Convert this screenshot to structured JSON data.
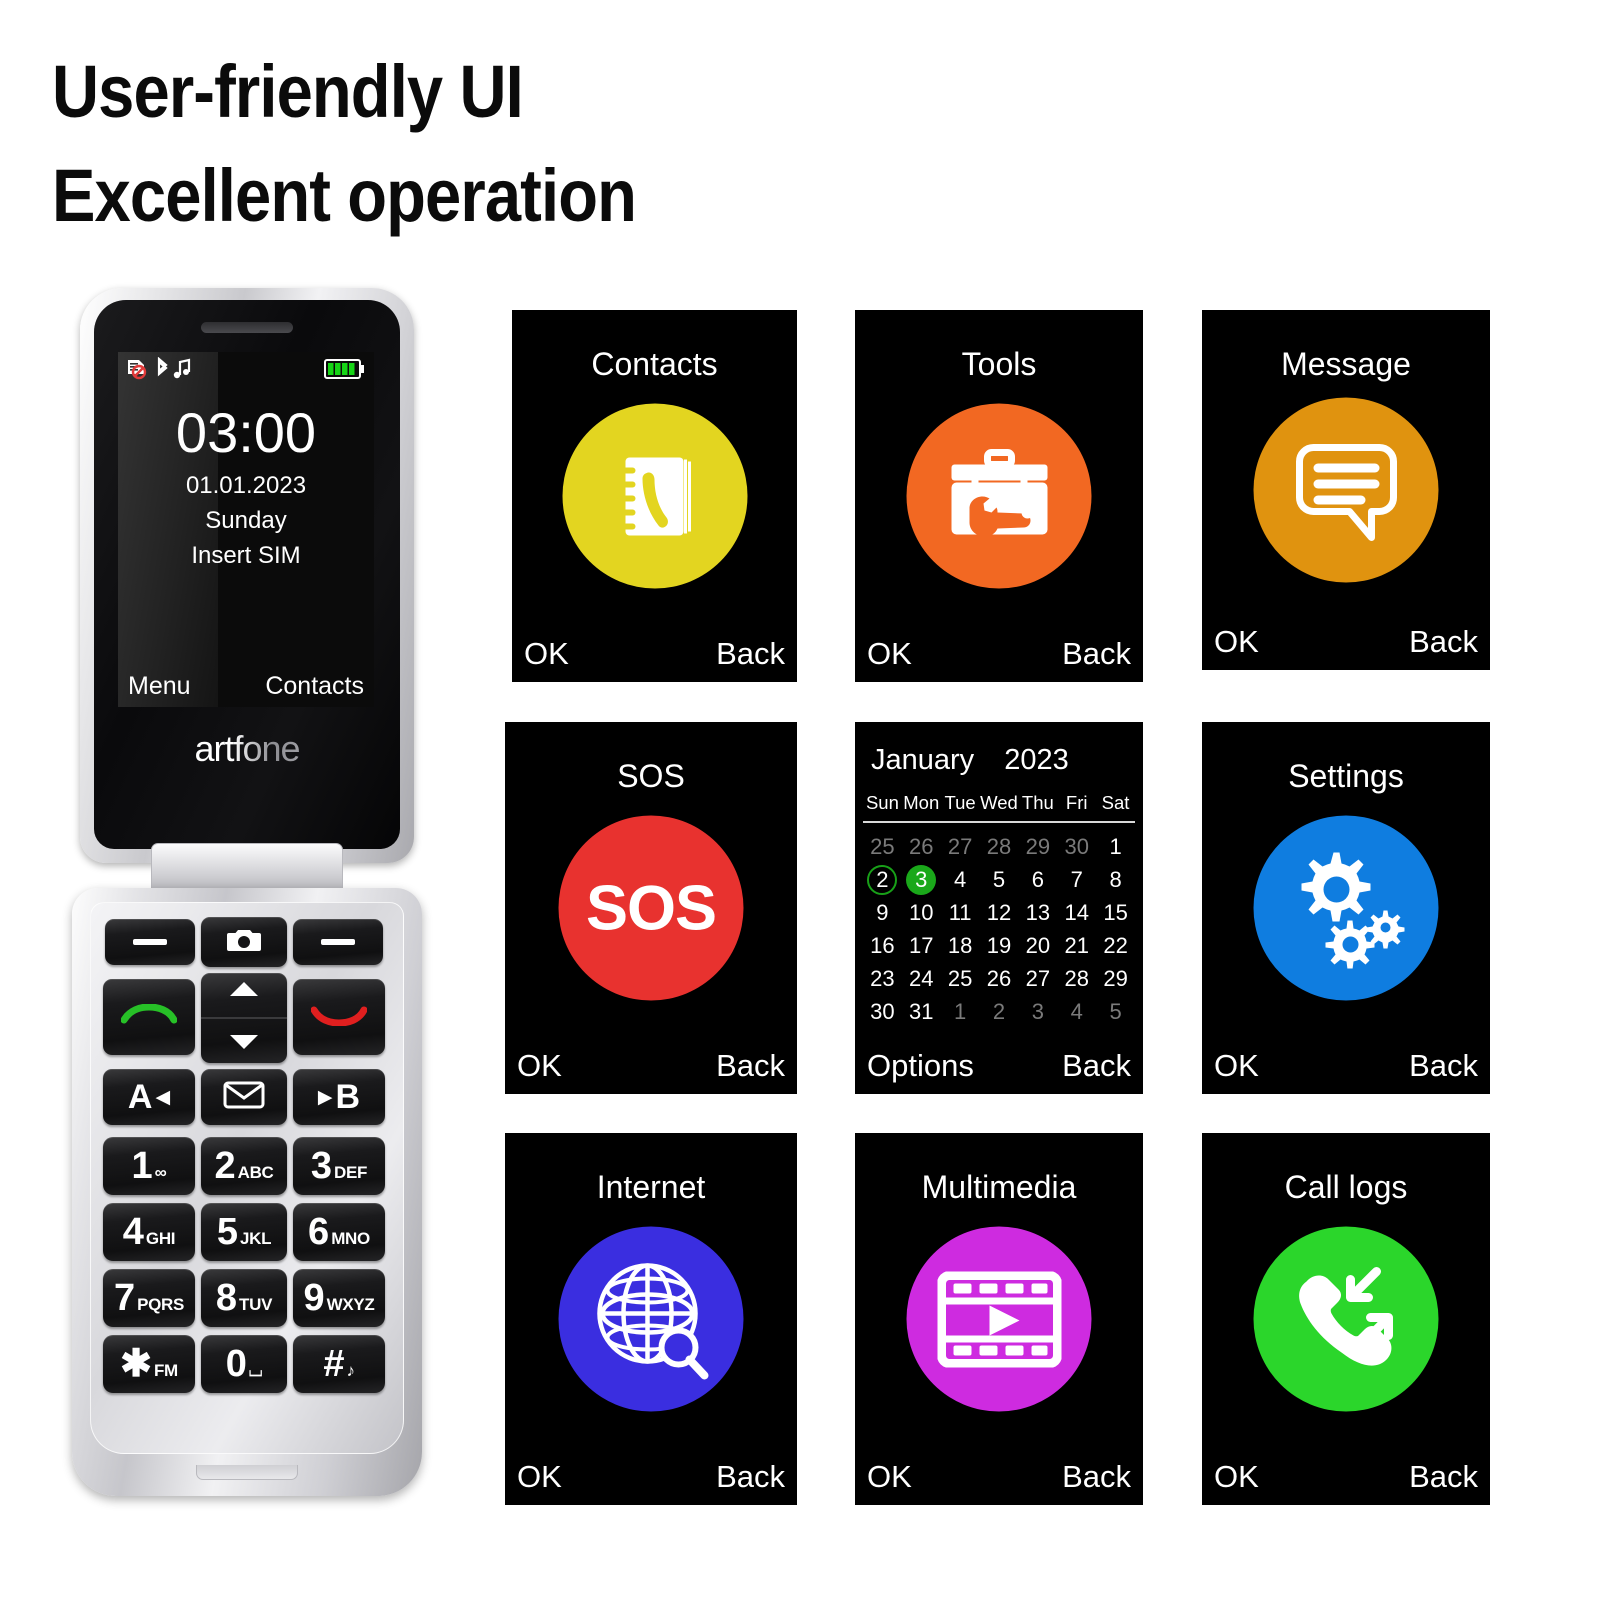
{
  "headline": {
    "line1": "User-friendly UI",
    "line2": "Excellent operation"
  },
  "phone": {
    "brand": "artfone",
    "screen": {
      "status_icons": [
        "sim-disabled-icon",
        "bluetooth-icon",
        "music-note-icon",
        "battery-icon"
      ],
      "time": "03:00",
      "date": "01.01.2023",
      "weekday": "Sunday",
      "sim_notice": "Insert SIM",
      "softkey_left": "Menu",
      "softkey_right": "Contacts"
    },
    "keys": {
      "softkey_left": "soft-key-left",
      "softkey_right": "soft-key-right",
      "camera": "camera-icon",
      "call": "call-start-icon",
      "end": "call-end-icon",
      "nav_up": "chevron-up-icon",
      "nav_down": "chevron-down-icon",
      "speed_a": "A",
      "speed_a_arrow": "◀",
      "message": "envelope-icon",
      "speed_b": "B",
      "speed_b_arrow": "▶",
      "numbers": [
        {
          "digit": "1",
          "sub": "∞",
          "name": "key-1"
        },
        {
          "digit": "2",
          "sub": "ABC",
          "name": "key-2"
        },
        {
          "digit": "3",
          "sub": "DEF",
          "name": "key-3"
        },
        {
          "digit": "4",
          "sub": "GHI",
          "name": "key-4"
        },
        {
          "digit": "5",
          "sub": "JKL",
          "name": "key-5"
        },
        {
          "digit": "6",
          "sub": "MNO",
          "name": "key-6"
        },
        {
          "digit": "7",
          "sub": "PQRS",
          "name": "key-7"
        },
        {
          "digit": "8",
          "sub": "TUV",
          "name": "key-8"
        },
        {
          "digit": "9",
          "sub": "WXYZ",
          "name": "key-9"
        },
        {
          "digit": "✱",
          "sub": "FM",
          "name": "key-star"
        },
        {
          "digit": "0",
          "sub": "⌴",
          "name": "key-0"
        },
        {
          "digit": "#",
          "sub": "♪",
          "name": "key-hash"
        }
      ]
    }
  },
  "footer_labels": {
    "ok": "OK",
    "back": "Back",
    "options": "Options"
  },
  "tiles": [
    {
      "title": "Contacts",
      "icon": "phonebook-icon",
      "color": "#E3D520",
      "footer_left": "OK",
      "footer_right": "Back"
    },
    {
      "title": "Tools",
      "icon": "toolbox-icon",
      "color": "#F26822",
      "footer_left": "OK",
      "footer_right": "Back"
    },
    {
      "title": "Message",
      "icon": "chat-bubble-icon",
      "color": "#E0930F",
      "footer_left": "OK",
      "footer_right": "Back"
    },
    {
      "title": "SOS",
      "icon": "sos-icon",
      "color": "#E8322F",
      "footer_left": "OK",
      "footer_right": "Back",
      "icon_text": "SOS"
    },
    {
      "title": "Settings",
      "icon": "gears-icon",
      "color": "#0F7DE0",
      "footer_left": "OK",
      "footer_right": "Back"
    },
    {
      "title": "Internet",
      "icon": "globe-search-icon",
      "color": "#3A2EE0",
      "footer_left": "OK",
      "footer_right": "Back"
    },
    {
      "title": "Multimedia",
      "icon": "film-play-icon",
      "color": "#CE2BE0",
      "footer_left": "OK",
      "footer_right": "Back"
    },
    {
      "title": "Call logs",
      "icon": "call-log-icon",
      "color": "#2BD62B",
      "footer_left": "OK",
      "footer_right": "Back"
    }
  ],
  "calendar": {
    "month": "January",
    "year": "2023",
    "weekdays": [
      "Sun",
      "Mon",
      "Tue",
      "Wed",
      "Thu",
      "Fri",
      "Sat"
    ],
    "footer_left": "Options",
    "footer_right": "Back",
    "highlight_ring": "2",
    "highlight_fill": "3",
    "weeks": [
      [
        {
          "d": "25",
          "o": true
        },
        {
          "d": "26",
          "o": true
        },
        {
          "d": "27",
          "o": true
        },
        {
          "d": "28",
          "o": true
        },
        {
          "d": "29",
          "o": true
        },
        {
          "d": "30",
          "o": true
        },
        {
          "d": "1",
          "o": false
        }
      ],
      [
        {
          "d": "2",
          "o": false,
          "ring": true
        },
        {
          "d": "3",
          "o": false,
          "fill": true
        },
        {
          "d": "4",
          "o": false
        },
        {
          "d": "5",
          "o": false
        },
        {
          "d": "6",
          "o": false
        },
        {
          "d": "7",
          "o": false
        },
        {
          "d": "8",
          "o": false
        }
      ],
      [
        {
          "d": "9",
          "o": false
        },
        {
          "d": "10",
          "o": false
        },
        {
          "d": "11",
          "o": false
        },
        {
          "d": "12",
          "o": false
        },
        {
          "d": "13",
          "o": false
        },
        {
          "d": "14",
          "o": false
        },
        {
          "d": "15",
          "o": false
        }
      ],
      [
        {
          "d": "16",
          "o": false
        },
        {
          "d": "17",
          "o": false
        },
        {
          "d": "18",
          "o": false
        },
        {
          "d": "19",
          "o": false
        },
        {
          "d": "20",
          "o": false
        },
        {
          "d": "21",
          "o": false
        },
        {
          "d": "22",
          "o": false
        }
      ],
      [
        {
          "d": "23",
          "o": false
        },
        {
          "d": "24",
          "o": false
        },
        {
          "d": "25",
          "o": false
        },
        {
          "d": "26",
          "o": false
        },
        {
          "d": "27",
          "o": false
        },
        {
          "d": "28",
          "o": false
        },
        {
          "d": "29",
          "o": false
        }
      ],
      [
        {
          "d": "30",
          "o": false
        },
        {
          "d": "31",
          "o": false
        },
        {
          "d": "1",
          "o": true
        },
        {
          "d": "2",
          "o": true
        },
        {
          "d": "3",
          "o": true
        },
        {
          "d": "4",
          "o": true
        },
        {
          "d": "5",
          "o": true
        }
      ]
    ]
  }
}
